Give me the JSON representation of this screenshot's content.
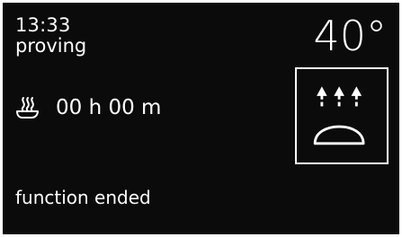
{
  "header": {
    "clock": "13:33",
    "mode": "proving",
    "temperature": "40°"
  },
  "timer": {
    "icon": "proving-bowl-icon",
    "value": "00 h 00 m"
  },
  "function_panel": {
    "icon": "proving-dough-heat-arrows-icon"
  },
  "status": {
    "message": "function ended"
  },
  "colors": {
    "background": "#0b0b0b",
    "foreground": "#ffffff"
  }
}
